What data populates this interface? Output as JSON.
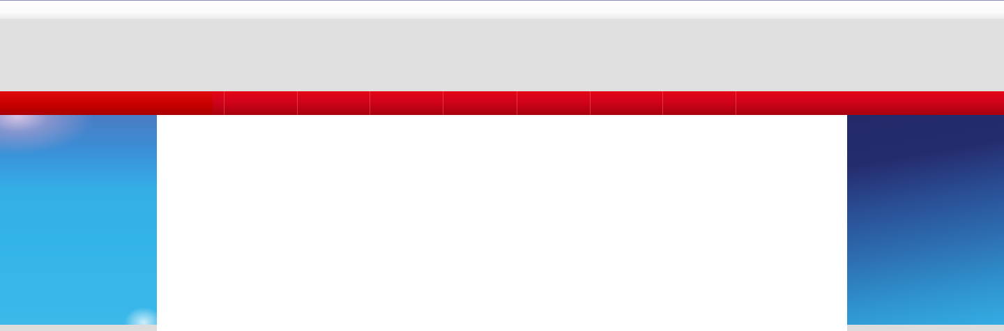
{
  "colors": {
    "nav_red": "#d0021a",
    "header_gray": "#e0e0e0",
    "left_banner_blue": "#33b4e8",
    "right_banner_navy": "#252c6e"
  },
  "header": {
    "logo_text": "",
    "banner_text": ""
  },
  "nav": {
    "items": [
      {
        "label": ""
      },
      {
        "label": ""
      },
      {
        "label": ""
      },
      {
        "label": ""
      },
      {
        "label": ""
      },
      {
        "label": ""
      },
      {
        "label": ""
      },
      {
        "label": ""
      }
    ]
  },
  "main": {
    "content_text": ""
  }
}
